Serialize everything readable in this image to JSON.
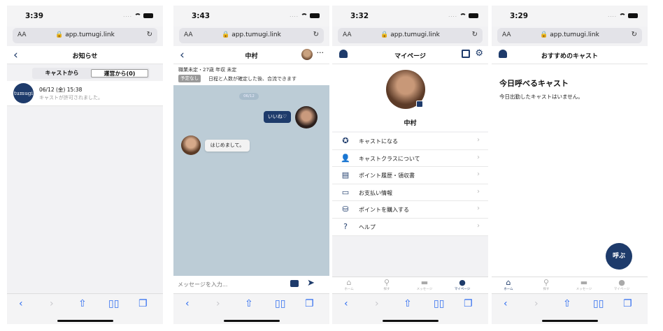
{
  "url": "app.tumugi.link",
  "aa": "AA",
  "screens": [
    {
      "time": "3:39",
      "title": "お知らせ",
      "tabs": [
        "キャストから",
        "運営から(0)"
      ],
      "notification": {
        "logo": "tumugi",
        "date": "06/12 (金) 15:38",
        "message": "キャストが許可されました。"
      }
    },
    {
      "time": "3:43",
      "title": "中村",
      "info_line": "職業未定・27歳 年収 未定",
      "tag": "予定なし",
      "info_note": "日程と人数が確定した後、合流できます",
      "day_label": "06/12",
      "sent_message": "いいね♡",
      "received_message": "はじめまして。",
      "input_placeholder": "メッセージを入力..."
    },
    {
      "time": "3:32",
      "title": "マイページ",
      "profile_name": "中村",
      "menu": [
        {
          "label": "キャストになる",
          "icon": "award-icon"
        },
        {
          "label": "キャストクラスについて",
          "icon": "user-plus-icon"
        },
        {
          "label": "ポイント履歴・領収書",
          "icon": "receipt-icon"
        },
        {
          "label": "お支払い情報",
          "icon": "card-icon"
        },
        {
          "label": "ポイントを購入する",
          "icon": "coins-icon"
        },
        {
          "label": "ヘルプ",
          "icon": "help-icon"
        }
      ],
      "tabs": [
        "ホーム",
        "探す",
        "メッセージ",
        "マイページ"
      ],
      "active_tab": "マイページ"
    },
    {
      "time": "3:29",
      "title": "おすすめのキャスト",
      "heading": "今日呼べるキャスト",
      "subtext": "今日出勤したキャストはいません。",
      "call_button": "呼ぶ",
      "tabs": [
        "ホーム",
        "探す",
        "メッセージ",
        "マイページ"
      ],
      "active_tab": "ホーム"
    }
  ],
  "colors": {
    "brand": "#1e3b6b",
    "chat_bg": "#bcccd6",
    "link_blue": "#2f6df0"
  }
}
